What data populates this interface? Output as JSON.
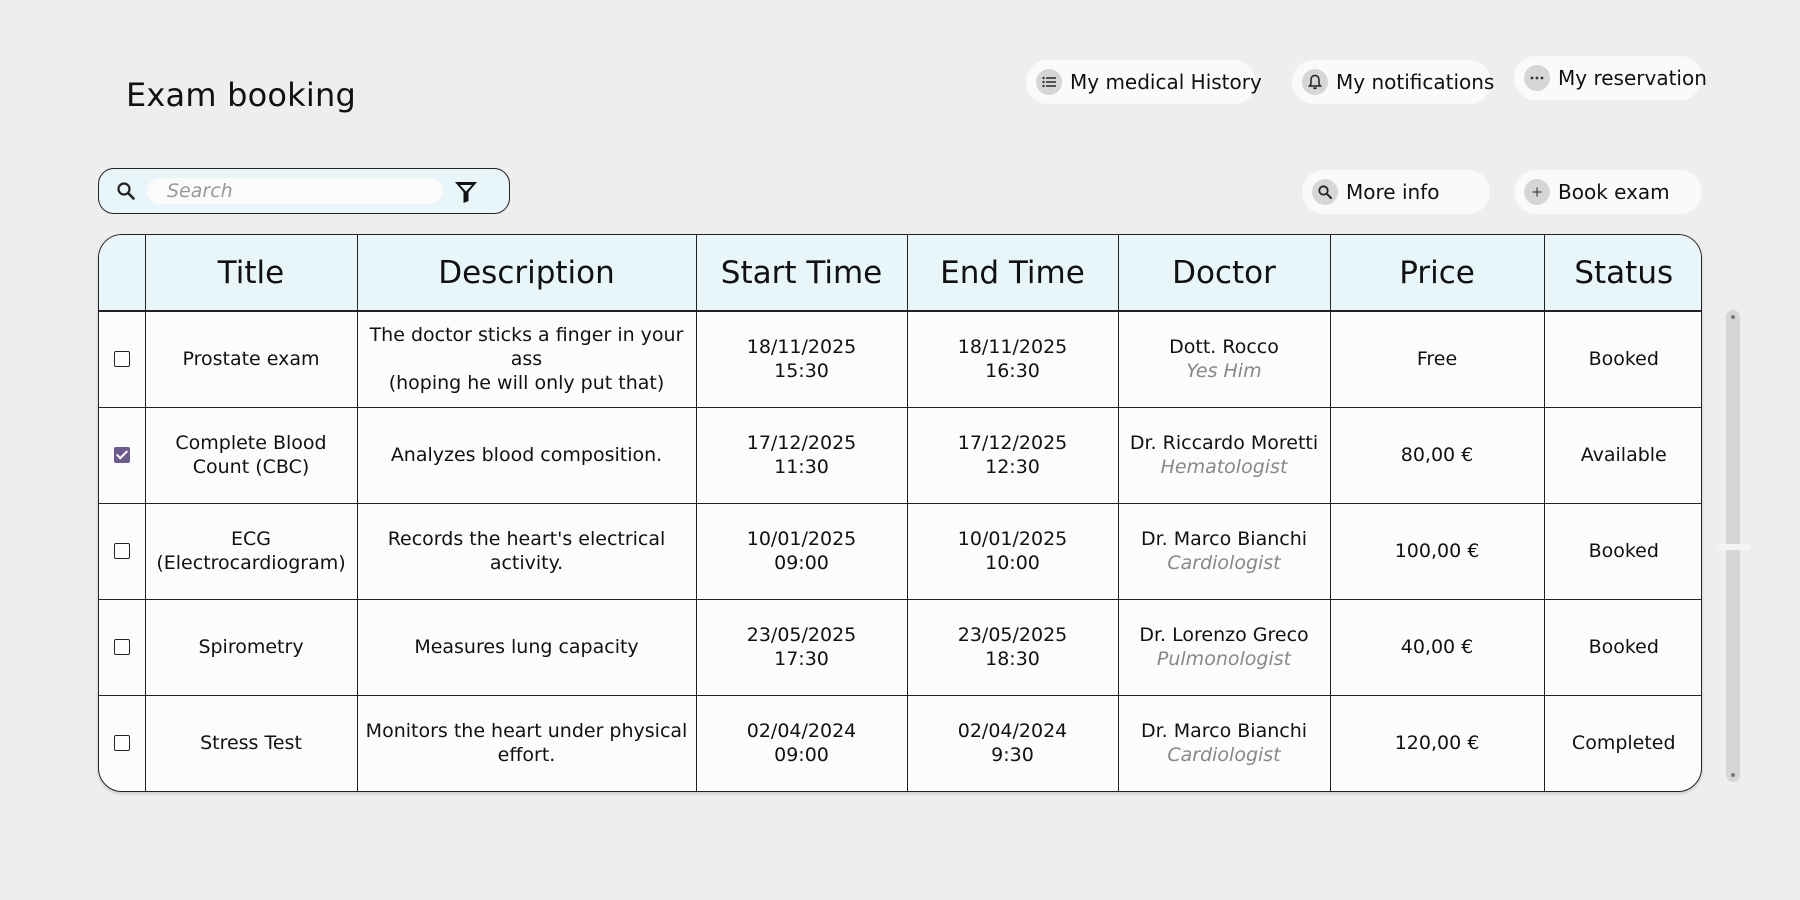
{
  "header": {
    "title": "Exam booking",
    "medical_history_label": "My medical History",
    "notifications_label": "My notifications",
    "reservation_label": "My reservation"
  },
  "toolbar": {
    "search_placeholder": "Search",
    "more_info_label": "More info",
    "book_exam_label": "Book exam"
  },
  "table": {
    "columns": [
      "Title",
      "Description",
      "Start Time",
      "End Time",
      "Doctor",
      "Price",
      "Status"
    ],
    "rows": [
      {
        "checked": false,
        "title": [
          "Prostate exam"
        ],
        "description": [
          "The doctor sticks a finger in your ass",
          "(hoping he will only put that)"
        ],
        "start": [
          "18/11/2025",
          "15:30"
        ],
        "end": [
          "18/11/2025",
          "16:30"
        ],
        "doctor": "Dott. Rocco",
        "specialty": "Yes Him",
        "price": "Free",
        "status": "Booked"
      },
      {
        "checked": true,
        "title": [
          "Complete Blood",
          "Count (CBC)"
        ],
        "description": [
          "Analyzes blood composition."
        ],
        "start": [
          "17/12/2025",
          "11:30"
        ],
        "end": [
          "17/12/2025",
          "12:30"
        ],
        "doctor": "Dr. Riccardo Moretti",
        "specialty": "Hematologist",
        "price": "80,00 €",
        "status": "Available"
      },
      {
        "checked": false,
        "title": [
          "ECG",
          "(Electrocardiogram)"
        ],
        "description": [
          "Records the heart's electrical",
          "activity."
        ],
        "start": [
          "10/01/2025",
          "09:00"
        ],
        "end": [
          "10/01/2025",
          "10:00"
        ],
        "doctor": "Dr. Marco Bianchi",
        "specialty": "Cardiologist",
        "price": "100,00 €",
        "status": "Booked"
      },
      {
        "checked": false,
        "title": [
          "Spirometry"
        ],
        "description": [
          "Measures lung capacity"
        ],
        "start": [
          "23/05/2025",
          "17:30"
        ],
        "end": [
          "23/05/2025",
          "18:30"
        ],
        "doctor": "Dr. Lorenzo Greco",
        "specialty": "Pulmonologist",
        "price": "40,00 €",
        "status": "Booked"
      },
      {
        "checked": false,
        "title": [
          "Stress Test"
        ],
        "description": [
          "Monitors the heart under physical",
          "effort."
        ],
        "start": [
          "02/04/2024",
          "09:00"
        ],
        "end": [
          "02/04/2024",
          "9:30"
        ],
        "doctor": "Dr. Marco Bianchi",
        "specialty": "Cardiologist",
        "price": "120,00 €",
        "status": "Completed"
      }
    ]
  },
  "icons": {
    "medical_history": "list-icon",
    "notifications": "bell-icon",
    "reservation": "more-dots-icon",
    "search": "search-icon",
    "filter": "filter-icon",
    "more_info": "search-icon",
    "book_exam": "plus-icon"
  },
  "colors": {
    "background": "#eeeeee",
    "header_fill": "#e8f5f9",
    "checkbox_checked": "#6d5b8e",
    "muted_text": "#888888"
  }
}
